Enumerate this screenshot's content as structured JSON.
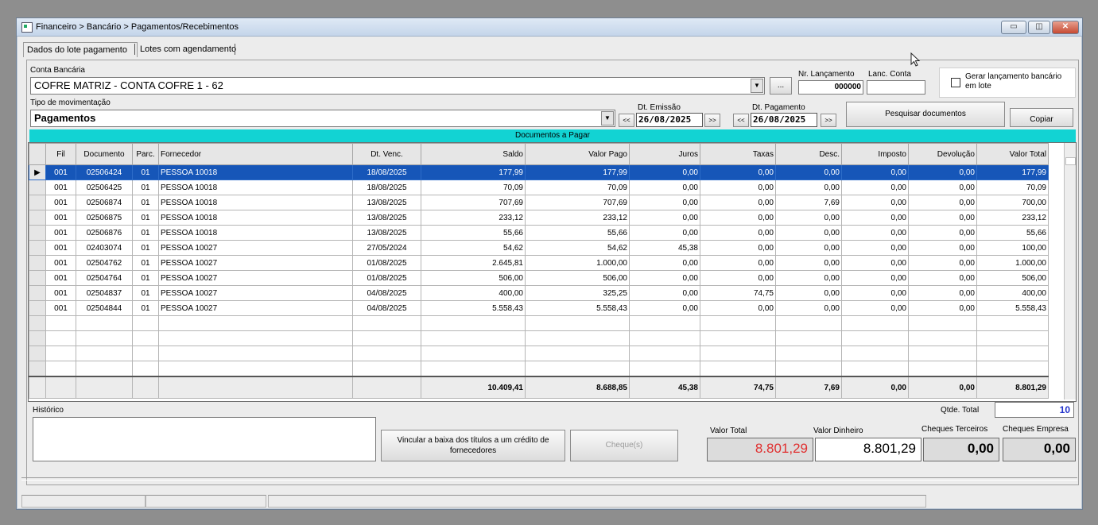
{
  "window": {
    "title": "Financeiro > Bancário > Pagamentos/Recebimentos",
    "buttons": {
      "minimize": "▭",
      "restore": "◫",
      "close": "✕"
    }
  },
  "tabs": [
    {
      "label": "Dados do lote pagamento"
    },
    {
      "label": "Lotes com agendamento"
    }
  ],
  "form": {
    "conta_bancaria_label": "Conta Bancária",
    "conta_bancaria_value": "COFRE MATRIZ - CONTA COFRE 1 - 62",
    "ellipsis_button": "...",
    "nr_lancamento_label": "Nr. Lançamento",
    "nr_lancamento_value": "000000",
    "lanc_conta_label": "Lanc. Conta",
    "lanc_conta_value": "",
    "gerar_lote_label": "Gerar lançamento bancário em lote",
    "tipo_mov_label": "Tipo de movimentação",
    "tipo_mov_value": "Pagamentos",
    "dt_emissao_label": "Dt. Emissão",
    "dt_emissao_value": "26/08/2025",
    "dt_pagamento_label": "Dt. Pagamento",
    "dt_pagamento_value": "26/08/2025",
    "prev_label": "<<",
    "next_label": ">>",
    "pesquisar_label": "Pesquisar documentos",
    "copiar_label": "Copiar"
  },
  "grid": {
    "title": "Documentos a Pagar",
    "columns": [
      "Fil",
      "Documento",
      "Parc.",
      "Fornecedor",
      "Dt. Venc.",
      "Saldo",
      "Valor Pago",
      "Juros",
      "Taxas",
      "Desc.",
      "Imposto",
      "Devolução",
      "Valor Total"
    ],
    "rows": [
      [
        "001",
        "02506424",
        "01",
        "PESSOA 10018",
        "18/08/2025",
        "177,99",
        "177,99",
        "0,00",
        "0,00",
        "0,00",
        "0,00",
        "0,00",
        "177,99"
      ],
      [
        "001",
        "02506425",
        "01",
        "PESSOA 10018",
        "18/08/2025",
        "70,09",
        "70,09",
        "0,00",
        "0,00",
        "0,00",
        "0,00",
        "0,00",
        "70,09"
      ],
      [
        "001",
        "02506874",
        "01",
        "PESSOA 10018",
        "13/08/2025",
        "707,69",
        "707,69",
        "0,00",
        "0,00",
        "7,69",
        "0,00",
        "0,00",
        "700,00"
      ],
      [
        "001",
        "02506875",
        "01",
        "PESSOA 10018",
        "13/08/2025",
        "233,12",
        "233,12",
        "0,00",
        "0,00",
        "0,00",
        "0,00",
        "0,00",
        "233,12"
      ],
      [
        "001",
        "02506876",
        "01",
        "PESSOA 10018",
        "13/08/2025",
        "55,66",
        "55,66",
        "0,00",
        "0,00",
        "0,00",
        "0,00",
        "0,00",
        "55,66"
      ],
      [
        "001",
        "02403074",
        "01",
        "PESSOA 10027",
        "27/05/2024",
        "54,62",
        "54,62",
        "45,38",
        "0,00",
        "0,00",
        "0,00",
        "0,00",
        "100,00"
      ],
      [
        "001",
        "02504762",
        "01",
        "PESSOA 10027",
        "01/08/2025",
        "2.645,81",
        "1.000,00",
        "0,00",
        "0,00",
        "0,00",
        "0,00",
        "0,00",
        "1.000,00"
      ],
      [
        "001",
        "02504764",
        "01",
        "PESSOA 10027",
        "01/08/2025",
        "506,00",
        "506,00",
        "0,00",
        "0,00",
        "0,00",
        "0,00",
        "0,00",
        "506,00"
      ],
      [
        "001",
        "02504837",
        "01",
        "PESSOA 10027",
        "04/08/2025",
        "400,00",
        "325,25",
        "0,00",
        "74,75",
        "0,00",
        "0,00",
        "0,00",
        "400,00"
      ],
      [
        "001",
        "02504844",
        "01",
        "PESSOA 10027",
        "04/08/2025",
        "5.558,43",
        "5.558,43",
        "0,00",
        "0,00",
        "0,00",
        "0,00",
        "0,00",
        "5.558,43"
      ]
    ],
    "empty_rows": 4,
    "selected_indicator": "▶",
    "totals": [
      "",
      "",
      "",
      "",
      "",
      "10.409,41",
      "8.688,85",
      "45,38",
      "74,75",
      "7,69",
      "0,00",
      "0,00",
      "8.801,29"
    ]
  },
  "footer": {
    "historico_label": "Histórico",
    "historico_value": "",
    "qtde_total_label": "Qtde. Total",
    "qtde_total_value": "10",
    "vincular_label": "Vincular a baixa dos títulos a um crédito de fornecedores",
    "cheques_button_label": "Cheque(s)",
    "valor_total_label": "Valor Total",
    "valor_total_value": "8.801,29",
    "valor_dinheiro_label": "Valor Dinheiro",
    "valor_dinheiro_value": "8.801,29",
    "cheques_terceiros_label": "Cheques Terceiros",
    "cheques_terceiros_value": "0,00",
    "cheques_empresa_label": "Cheques Empresa",
    "cheques_empresa_value": "0,00"
  },
  "colors": {
    "grid_header_band": "#12d3d3",
    "selected_row": "#1656b8",
    "valor_total_text": "#e03030",
    "qtde_total_text": "#2233cc"
  }
}
